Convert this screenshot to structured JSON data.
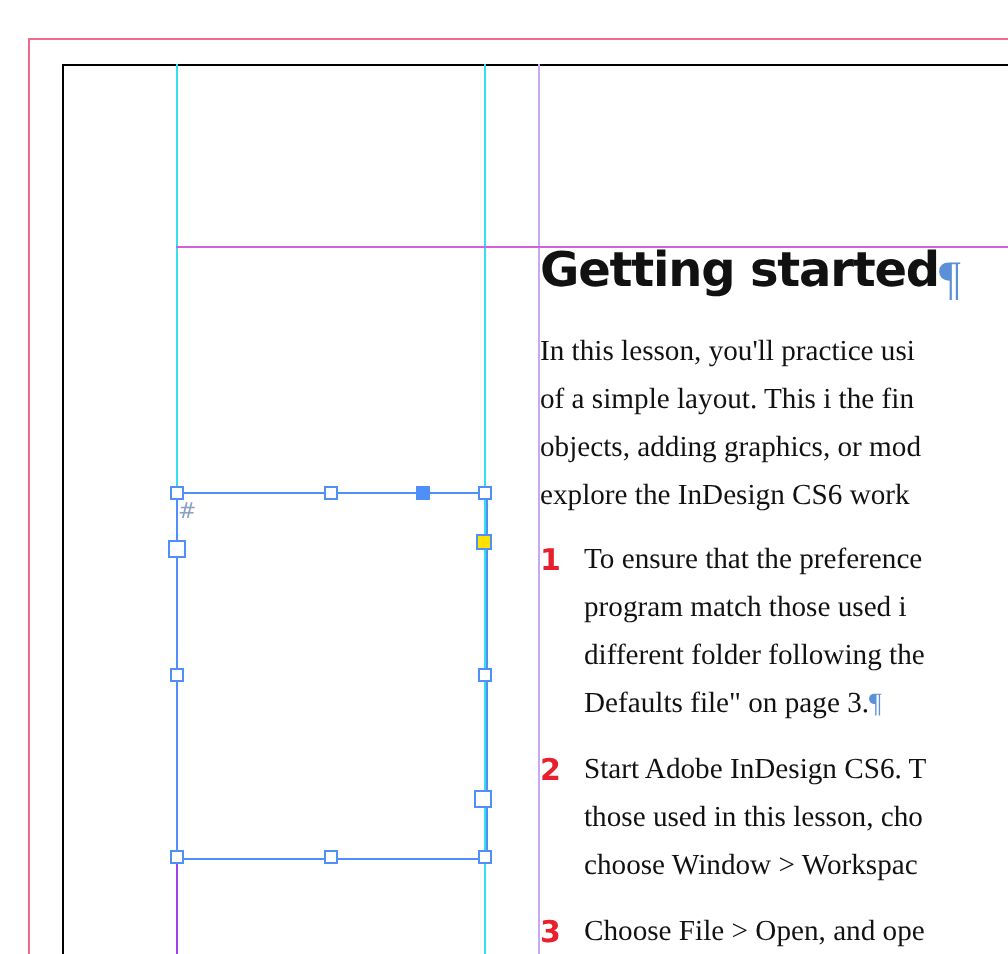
{
  "frame": {
    "marker": "#"
  },
  "story": {
    "heading": "Getting started",
    "heading_pilcrow": "¶",
    "intro_lines": [
      "In this lesson, you'll practice usi",
      "of a simple layout. This i the fin",
      "objects, adding graphics, or mod",
      "explore the InDesign CS6 work"
    ],
    "steps": [
      {
        "number": "1",
        "lines": [
          "To ensure that the preference",
          "program match those used i",
          "different folder following the",
          "Defaults file\" on page 3."
        ],
        "pilcrow": "¶"
      },
      {
        "number": "2",
        "lines": [
          "Start Adobe InDesign CS6. T",
          "those used in this lesson, cho",
          "choose Window > Workspac"
        ]
      },
      {
        "number": "3",
        "lines": [
          "Choose File > Open, and ope"
        ]
      }
    ]
  }
}
